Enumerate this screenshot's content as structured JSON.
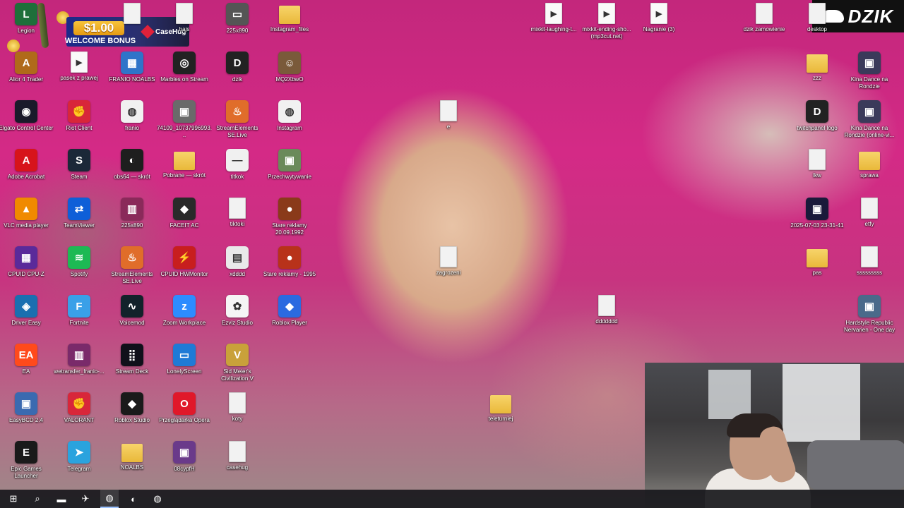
{
  "promo": {
    "amount": "$1.00",
    "welcome": "WELCOME BONUS",
    "brand": "CaseHug"
  },
  "logo_badge": {
    "text": "DZIK"
  },
  "desktop_icons": [
    {
      "label": "Legion",
      "kind": "app",
      "color": "#1f6f3a",
      "glyph": "L"
    },
    {
      "label": "",
      "kind": "file",
      "color": "",
      "glyph": ""
    },
    {
      "label": "hajs",
      "kind": "file",
      "color": "",
      "glyph": ""
    },
    {
      "label": "225x890",
      "kind": "app",
      "color": "#555",
      "glyph": "▭"
    },
    {
      "label": "Instagram_files",
      "kind": "folder",
      "color": "",
      "glyph": ""
    },
    {
      "label": "mixkit-laughing-t...",
      "kind": "play",
      "color": "",
      "glyph": "▶"
    },
    {
      "label": "mixkit-ending-sho... (mp3cut.net)",
      "kind": "play",
      "color": "",
      "glyph": "▶"
    },
    {
      "label": "Nagranie (3)",
      "kind": "play",
      "color": "",
      "glyph": "▶"
    },
    {
      "label": "dzik zamowienie",
      "kind": "file",
      "color": "",
      "glyph": ""
    },
    {
      "label": "desktop",
      "kind": "file",
      "color": "",
      "glyph": ""
    },
    {
      "label": "Alior 4 Trader",
      "kind": "app",
      "color": "#b06a1a",
      "glyph": "A"
    },
    {
      "label": "pasek z prawej",
      "kind": "play",
      "color": "",
      "glyph": "▶"
    },
    {
      "label": "FRANIO NOALBS",
      "kind": "app",
      "color": "#2f74c9",
      "glyph": "▦"
    },
    {
      "label": "Marbles on Stream",
      "kind": "app",
      "color": "#222",
      "glyph": "◎"
    },
    {
      "label": "dzik",
      "kind": "app",
      "color": "#222",
      "glyph": "D"
    },
    {
      "label": "MQ2XbwO",
      "kind": "app",
      "color": "#7a5a3a",
      "glyph": "☺"
    },
    {
      "label": "zzz",
      "kind": "folder",
      "color": "",
      "glyph": ""
    },
    {
      "label": "Kina Dance na Rondzie",
      "kind": "app",
      "color": "#3a3a5a",
      "glyph": "▣"
    },
    {
      "label": "Elgato Control Center",
      "kind": "app",
      "color": "#1a1a2a",
      "glyph": "◉"
    },
    {
      "label": "Riot Client",
      "kind": "app",
      "color": "#d8263a",
      "glyph": "✊"
    },
    {
      "label": "franio",
      "kind": "app",
      "color": "#f1f1f1",
      "glyph": "◍"
    },
    {
      "label": "74109_10737996993...",
      "kind": "app",
      "color": "#6a6a6a",
      "glyph": "▣"
    },
    {
      "label": "StreamElements SE.Live",
      "kind": "app",
      "color": "#e06d2a",
      "glyph": "♨"
    },
    {
      "label": "Instagram",
      "kind": "app",
      "color": "#f1f1f1",
      "glyph": "◍"
    },
    {
      "label": "e",
      "kind": "file",
      "color": "",
      "glyph": ""
    },
    {
      "label": "twitchpanel logo",
      "kind": "app",
      "color": "#222",
      "glyph": "D"
    },
    {
      "label": "Kina Dance na Rondzie (online-vi...",
      "kind": "app",
      "color": "#3a3a5a",
      "glyph": "▣"
    },
    {
      "label": "Adobe Acrobat",
      "kind": "app",
      "color": "#d7141a",
      "glyph": "A"
    },
    {
      "label": "Steam",
      "kind": "app",
      "color": "#1b2838",
      "glyph": "S"
    },
    {
      "label": "obs64 — skrót",
      "kind": "app",
      "color": "#1e1e1e",
      "glyph": "◐"
    },
    {
      "label": "Pobrane — skrót",
      "kind": "folder",
      "color": "",
      "glyph": ""
    },
    {
      "label": "titkok",
      "kind": "app",
      "color": "#f0f0f0",
      "glyph": "—"
    },
    {
      "label": "Przechwytywanie",
      "kind": "app",
      "color": "#6a8a5a",
      "glyph": "▣"
    },
    {
      "label": "lkw",
      "kind": "file",
      "color": "",
      "glyph": ""
    },
    {
      "label": "sprawa",
      "kind": "folder",
      "color": "",
      "glyph": ""
    },
    {
      "label": "VLC media player",
      "kind": "app",
      "color": "#f08a00",
      "glyph": "▲"
    },
    {
      "label": "TeamViewer",
      "kind": "app",
      "color": "#0e5fd8",
      "glyph": "⇄"
    },
    {
      "label": "225x890",
      "kind": "app",
      "color": "#8a2a5a",
      "glyph": "▥"
    },
    {
      "label": "FACEIT AC",
      "kind": "app",
      "color": "#2a2a2a",
      "glyph": "◆"
    },
    {
      "label": "tiktoki",
      "kind": "file",
      "color": "",
      "glyph": ""
    },
    {
      "label": "Stare reklamy 20.09.1992",
      "kind": "app",
      "color": "#8a3a1a",
      "glyph": "●"
    },
    {
      "label": "2025-07-03 23-31-41",
      "kind": "app",
      "color": "#1a1a3a",
      "glyph": "▣"
    },
    {
      "label": "etfy",
      "kind": "file",
      "color": "",
      "glyph": ""
    },
    {
      "label": "CPUID CPU-Z",
      "kind": "app",
      "color": "#5a2a9a",
      "glyph": "▦"
    },
    {
      "label": "Spotify",
      "kind": "app",
      "color": "#1db954",
      "glyph": "≋"
    },
    {
      "label": "StreamElements SE.Live",
      "kind": "app",
      "color": "#e06d2a",
      "glyph": "♨"
    },
    {
      "label": "CPUID HWMonitor",
      "kind": "app",
      "color": "#c81e1e",
      "glyph": "⚡"
    },
    {
      "label": "xdddd",
      "kind": "app",
      "color": "#e9e9e9",
      "glyph": "▤"
    },
    {
      "label": "Stare reklamy - 1995",
      "kind": "app",
      "color": "#b8321a",
      "glyph": "●"
    },
    {
      "label": "zagrozeni",
      "kind": "file",
      "color": "",
      "glyph": ""
    },
    {
      "label": "pas",
      "kind": "folder",
      "color": "",
      "glyph": ""
    },
    {
      "label": "sssssssss",
      "kind": "file",
      "color": "",
      "glyph": ""
    },
    {
      "label": "Driver Easy",
      "kind": "app",
      "color": "#1a6fb0",
      "glyph": "◈"
    },
    {
      "label": "Fortnite",
      "kind": "app",
      "color": "#3aa0e8",
      "glyph": "F"
    },
    {
      "label": "Voicemod",
      "kind": "app",
      "color": "#12222a",
      "glyph": "∿"
    },
    {
      "label": "Zoom Workplace",
      "kind": "app",
      "color": "#2d8cff",
      "glyph": "z"
    },
    {
      "label": "Ezviz Studio",
      "kind": "app",
      "color": "#f5f5f5",
      "glyph": "✿"
    },
    {
      "label": "Roblox Player",
      "kind": "app",
      "color": "#2b6ae0",
      "glyph": "◆"
    },
    {
      "label": "ddddddd",
      "kind": "file",
      "color": "",
      "glyph": ""
    },
    {
      "label": "Hardstyle Republic Nervarien - One day",
      "kind": "app",
      "color": "#4a6a8a",
      "glyph": "▣"
    },
    {
      "label": "EA",
      "kind": "app",
      "color": "#ff4a1c",
      "glyph": "EA"
    },
    {
      "label": "wetransfer_franio-...",
      "kind": "app",
      "color": "#7a2a6a",
      "glyph": "▥"
    },
    {
      "label": "Stream Deck",
      "kind": "app",
      "color": "#10101a",
      "glyph": "⣿"
    },
    {
      "label": "LonelyScreen",
      "kind": "app",
      "color": "#1f7ad6",
      "glyph": "▭"
    },
    {
      "label": "Sid Meier's Civilization V",
      "kind": "app",
      "color": "#c9a13a",
      "glyph": "V"
    },
    {
      "label": "EasyBCD 2.4",
      "kind": "app",
      "color": "#3a6ab0",
      "glyph": "▣"
    },
    {
      "label": "VALORANT",
      "kind": "app",
      "color": "#d8263a",
      "glyph": "✊"
    },
    {
      "label": "Roblox Studio",
      "kind": "app",
      "color": "#1a1a1a",
      "glyph": "◆"
    },
    {
      "label": "Przeglądarka Opera",
      "kind": "app",
      "color": "#e0182a",
      "glyph": "O"
    },
    {
      "label": "koty",
      "kind": "file",
      "color": "",
      "glyph": ""
    },
    {
      "label": "teleturniej",
      "kind": "folder",
      "color": "",
      "glyph": ""
    },
    {
      "label": "Epic Games Launcher",
      "kind": "app",
      "color": "#1a1a1a",
      "glyph": "E"
    },
    {
      "label": "Telegram",
      "kind": "app",
      "color": "#2aa3de",
      "glyph": "➤"
    },
    {
      "label": "NOALBS",
      "kind": "folder",
      "color": "",
      "glyph": ""
    },
    {
      "label": "08cypfH",
      "kind": "app",
      "color": "#6a3a8a",
      "glyph": "▣"
    },
    {
      "label": "casehug",
      "kind": "file",
      "color": "",
      "glyph": ""
    }
  ],
  "taskbar": {
    "items": [
      {
        "name": "start-button",
        "glyph": "⊞",
        "active": false
      },
      {
        "name": "search-button",
        "glyph": "⌕",
        "active": false
      },
      {
        "name": "file-explorer-button",
        "glyph": "▬",
        "active": false
      },
      {
        "name": "app-1-button",
        "glyph": "✈",
        "active": false
      },
      {
        "name": "chrome-button",
        "glyph": "◍",
        "active": true
      },
      {
        "name": "app-2-button",
        "glyph": "◐",
        "active": false
      },
      {
        "name": "app-3-button",
        "glyph": "◍",
        "active": false
      }
    ]
  }
}
